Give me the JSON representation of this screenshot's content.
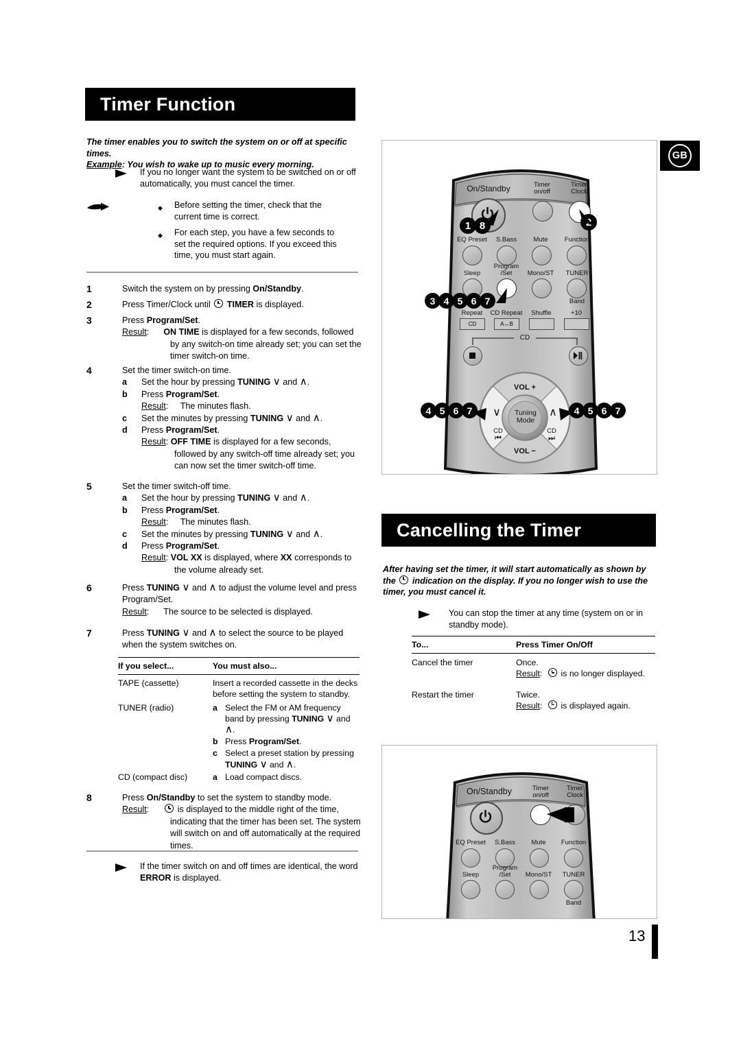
{
  "page": {
    "number": "13",
    "region_badge": "GB"
  },
  "section1": {
    "title": "Timer Function",
    "intro_line1": "The timer enables you to switch the system on or off at specific times.",
    "intro_example_label": "Example",
    "intro_line2": ": You wish to wake up to music every morning.",
    "arrow_note": "If you no longer want the system to be switched on or off automatically, you must cancel the timer.",
    "hand_notes": [
      "Before setting the timer, check that the current time is correct.",
      "For each step, you have a few seconds to set the required options. If you exceed this time, you must start again."
    ],
    "steps": [
      {
        "num": "1",
        "text_pre": "Switch the system on by pressing ",
        "text_bold": "On/Standby",
        "text_post": "."
      },
      {
        "num": "2",
        "text_pre": "Press Timer/Clock until ",
        "icon": "clock-icon",
        "text_bold": "TIMER",
        "text_post": " is displayed."
      },
      {
        "num": "3",
        "line_pre": "Press ",
        "line_bold": "Program/Set",
        "line_post": ".",
        "result_label": "Result",
        "result_bold": "ON TIME",
        "result_text": " is displayed  for a few seconds, followed by any switch-on time already set; you can set the timer switch-on time."
      },
      {
        "num": "4",
        "heading": "Set the timer switch-on time.",
        "subs": [
          {
            "letter": "a",
            "text": "Set the hour by pressing ",
            "bold": "TUNING",
            "mid": " and ",
            "tail": "."
          },
          {
            "letter": "b",
            "text": "Press ",
            "bold": "Program/Set",
            "tail": ".",
            "result_label": "Result",
            "result_text": "The minutes flash."
          },
          {
            "letter": "c",
            "text": "Set the minutes by pressing ",
            "bold": "TUNING",
            "mid": " and ",
            "tail": "."
          },
          {
            "letter": "d",
            "text": "Press ",
            "bold": "Program/Set",
            "tail": ".",
            "result_label": "Result",
            "result_bold": "OFF TIME",
            "result_text": " is displayed  for a few seconds, followed by any switch-off time already set; you can now set the timer switch-off time."
          }
        ]
      },
      {
        "num": "5",
        "heading": "Set the timer switch-off time.",
        "subs": [
          {
            "letter": "a",
            "text": "Set the hour by pressing ",
            "bold": "TUNING",
            "mid": " and ",
            "tail": "."
          },
          {
            "letter": "b",
            "text": "Press ",
            "bold": "Program/Set",
            "tail": ".",
            "result_label": "Result",
            "result_text": "The minutes flash."
          },
          {
            "letter": "c",
            "text": "Set the minutes by pressing ",
            "bold": "TUNING",
            "mid": " and ",
            "tail": "."
          },
          {
            "letter": "d",
            "text": "Press ",
            "bold": "Program/Set",
            "tail": ".",
            "result_label": "Result",
            "result_bold": "VOL XX",
            "result_text2": " is displayed, where ",
            "result_bold2": "XX",
            "result_text3": " corresponds to the volume already set."
          }
        ]
      },
      {
        "num": "6",
        "pre": "Press ",
        "bold": "TUNING",
        "mid": " and ",
        "post": " to adjust the volume level and press Program/Set.",
        "result_label": "Result",
        "result_text": "The source to be selected is displayed."
      },
      {
        "num": "7",
        "pre": "Press ",
        "bold": "TUNING",
        "mid": " and ",
        "post": " to select the source to be played when the system switches on."
      },
      {
        "num": "8",
        "pre": "Press ",
        "bold": "On/Standby",
        "post": " to set the system to standby mode.",
        "result_label": "Result",
        "result_text": " is displayed to the middle right of the time, indicating that the timer has been set. The system will switch on and off automatically at the required times."
      }
    ],
    "source_table": {
      "header": {
        "col1": "If you select...",
        "col2": "You must also..."
      },
      "rows": [
        {
          "col1": "TAPE (cassette)",
          "col2_lines": [
            "Insert a recorded cassette in the decks before setting the system to standby."
          ]
        },
        {
          "col1": "TUNER (radio)",
          "subs": [
            {
              "letter": "a",
              "pre": "Select the FM or AM frequency band by pressing ",
              "bold": "TUNING",
              "tail": " and ."
            },
            {
              "letter": "b",
              "pre": "Press ",
              "bold": "Program/Set",
              "tail": "."
            },
            {
              "letter": "c",
              "pre": "Select a preset station by pressing ",
              "bold": "TUNING",
              "tail": " and ."
            }
          ]
        },
        {
          "col1": "CD (compact disc)",
          "subs": [
            {
              "letter": "a",
              "pre": "Load compact discs.",
              "bold": "",
              "tail": ""
            }
          ]
        }
      ]
    },
    "final_note_pre": "If the timer switch on and off times are identical, the word ",
    "final_note_bold": "ERROR",
    "final_note_post": " is displayed."
  },
  "section2": {
    "title": "Cancelling the Timer",
    "intro_a": "After having set the timer, it will start automatically as shown by the ",
    "intro_b": " indication on the display. If you no longer wish to use the timer, you must cancel it.",
    "arrow_note": "You can stop the timer at any time (system on or in standby mode).",
    "table": {
      "header": {
        "col1": "To...",
        "col2": "Press Timer On/Off"
      },
      "rows": [
        {
          "col1": "Cancel the timer",
          "col2_first": "Once.",
          "result_label": "Result",
          "result_text": "is no longer displayed."
        },
        {
          "col1": "Restart the timer",
          "col2_first": "Twice.",
          "result_label": "Result",
          "result_text": "is displayed again."
        }
      ]
    }
  },
  "remote_top": {
    "labels": {
      "on_standby": "On/Standby",
      "timer_onoff_l1": "Timer",
      "timer_onoff_l2": "on/off",
      "timer_clock_l1": "Timer",
      "timer_clock_l2": "Clock",
      "eq_preset": "EQ Preset",
      "s_bass": "S.Bass",
      "mute": "Mute",
      "function": "Function",
      "sleep": "Sleep",
      "program_l1": "Program",
      "program_l2": "/Set",
      "mono_st": "Mono/ST",
      "tuner": "TUNER",
      "band": "Band",
      "repeat": "Repeat",
      "repeat_btn": "CD",
      "cd_repeat": "CD Repeat",
      "cd_repeat_btn": "A↔B",
      "shuffle": "Shuffle",
      "plus_ten": "+10",
      "cd_bracket": "CD",
      "vol_up": "VOL +",
      "vol_down": "VOL −",
      "tuning_mode_l1": "Tuning",
      "tuning_mode_l2": "Mode",
      "cd_prev_l1": "CD",
      "cd_prev_l2": "⏮",
      "cd_next_l1": "CD",
      "cd_next_l2": "⏭",
      "stop": "■",
      "playpause": "▶‖"
    },
    "callouts_power_left": [
      "1",
      "8"
    ],
    "callouts_power_right": [
      "2"
    ],
    "callouts_program": [
      "3",
      "4",
      "5",
      "6",
      "7"
    ],
    "callouts_nav_left": [
      "4",
      "5",
      "6",
      "7"
    ],
    "callouts_nav_right": [
      "4",
      "5",
      "6",
      "7"
    ]
  },
  "remote_bottom": {
    "labels": {
      "on_standby": "On/Standby",
      "timer_onoff_l1": "Timer",
      "timer_onoff_l2": "on/off",
      "timer_clock_l1": "Timer",
      "timer_clock_l2": "Clock",
      "eq_preset": "EQ Preset",
      "s_bass": "S.Bass",
      "mute": "Mute",
      "function": "Function",
      "sleep": "Sleep",
      "program_l1": "Program",
      "program_l2": "/Set",
      "mono_st": "Mono/ST",
      "tuner": "TUNER",
      "band": "Band"
    }
  }
}
